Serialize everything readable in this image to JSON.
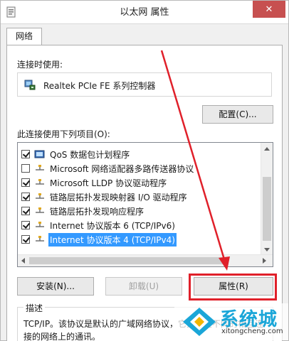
{
  "window": {
    "title": "以太网 属性",
    "close_glyph": "✕"
  },
  "tabs": [
    {
      "label": "网络"
    }
  ],
  "connect_using": {
    "label": "连接时使用:",
    "adapter_name": "Realtek PCIe FE 系列控制器",
    "adapter_icon": "network-adapter-icon"
  },
  "buttons": {
    "configure": "配置(C)...",
    "install": "安装(N)...",
    "uninstall": "卸载(U)",
    "properties": "属性(R)"
  },
  "items_label": "此连接使用下列项目(O):",
  "items": [
    {
      "label": "QoS 数据包计划程序",
      "checked": true,
      "icon": "qos-scheduler-icon",
      "selected": false
    },
    {
      "label": "Microsoft 网络适配器多路传送器协议",
      "checked": false,
      "icon": "protocol-icon",
      "selected": false
    },
    {
      "label": "Microsoft LLDP 协议驱动程序",
      "checked": true,
      "icon": "protocol-icon",
      "selected": false
    },
    {
      "label": "链路层拓扑发现映射器 I/O 驱动程序",
      "checked": true,
      "icon": "protocol-icon",
      "selected": false
    },
    {
      "label": "链路层拓扑发现响应程序",
      "checked": true,
      "icon": "protocol-icon",
      "selected": false
    },
    {
      "label": "Internet 协议版本 6 (TCP/IPv6)",
      "checked": true,
      "icon": "protocol-icon",
      "selected": false
    },
    {
      "label": "Internet 协议版本 4 (TCP/IPv4)",
      "checked": true,
      "icon": "protocol-icon",
      "selected": true
    }
  ],
  "description": {
    "title": "描述",
    "text": "TCP/IP。该协议是默认的广域网络协议，它提供在不同的相互连接的网络上的通讯。"
  },
  "watermark": {
    "main": "系统城",
    "sub": "xitongcheng.com"
  },
  "colors": {
    "selection": "#3399ff",
    "annotation": "#e0202a",
    "watermark": "#1aa6d8"
  }
}
